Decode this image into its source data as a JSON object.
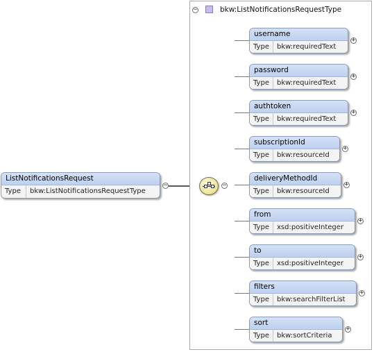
{
  "root": {
    "name": "ListNotificationsRequest",
    "type_label": "Type",
    "type_value": "bkw:ListNotificationsRequestType"
  },
  "complex_type": {
    "name": "bkw:ListNotificationsRequestType"
  },
  "elements": [
    {
      "name": "username",
      "type_label": "Type",
      "type_value": "bkw:requiredText"
    },
    {
      "name": "password",
      "type_label": "Type",
      "type_value": "bkw:requiredText"
    },
    {
      "name": "authtoken",
      "type_label": "Type",
      "type_value": "bkw:requiredText"
    },
    {
      "name": "subscriptionId",
      "type_label": "Type",
      "type_value": "bkw:resourceId"
    },
    {
      "name": "deliveryMethodId",
      "type_label": "Type",
      "type_value": "bkw:resourceId"
    },
    {
      "name": "from",
      "type_label": "Type",
      "type_value": "xsd:positiveInteger"
    },
    {
      "name": "to",
      "type_label": "Type",
      "type_value": "xsd:positiveInteger"
    },
    {
      "name": "filters",
      "type_label": "Type",
      "type_value": "bkw:searchFilterList"
    },
    {
      "name": "sort",
      "type_label": "Type",
      "type_value": "bkw:sortCriteria"
    }
  ],
  "toggles": {
    "collapse": "−",
    "expand": "+"
  },
  "colors": {
    "element_header": "#c9d8f3",
    "border": "#8a9bb5",
    "type_swatch": "#c9bde6",
    "sequence": "#eee49a"
  }
}
